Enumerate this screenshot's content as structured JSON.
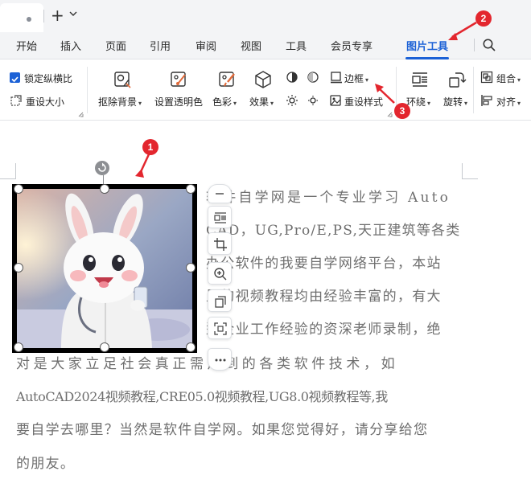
{
  "titlebar": {
    "tab_dot": "•",
    "new_tab": "+",
    "new_tab_menu": "⌄"
  },
  "menu": {
    "items": [
      "开始",
      "插入",
      "页面",
      "引用",
      "审阅",
      "视图",
      "工具",
      "会员专享",
      "图片工具"
    ],
    "active": "图片工具"
  },
  "ribbon": {
    "lock_ratio": "锁定纵横比",
    "reset_size": "重设大小",
    "remove_bg": "抠除背景",
    "set_transparent": "设置透明色",
    "color": "色彩",
    "effects": "效果",
    "border": "边框",
    "reset_style": "重设样式",
    "wrap": "环绕",
    "rotate": "旋转",
    "group": "组合",
    "align": "对齐"
  },
  "document": {
    "lines": [
      "软件自学网是一个专业学习 Auto",
      "CAD，UG,Pro/E,PS,天正建筑等各类",
      "办公软件的我要自学网络平台，本站",
      "里的视频教程均由经验丰富的，有大",
      "型企业工作经验的资深老师录制，绝",
      "对是大家立足社会真正需用到的各类软件技术，如",
      "AutoCAD2024视频教程,CRE05.0视频教程,UG8.0视频教程等,我",
      "要自学去哪里？当然是软件自学网。如果您觉得好，请分享给您",
      "的朋友。"
    ]
  },
  "annotations": [
    "1",
    "2",
    "3"
  ],
  "colors": {
    "accent": "#1c61d6",
    "badge": "#e3262e",
    "text": "#6e6e6e"
  }
}
